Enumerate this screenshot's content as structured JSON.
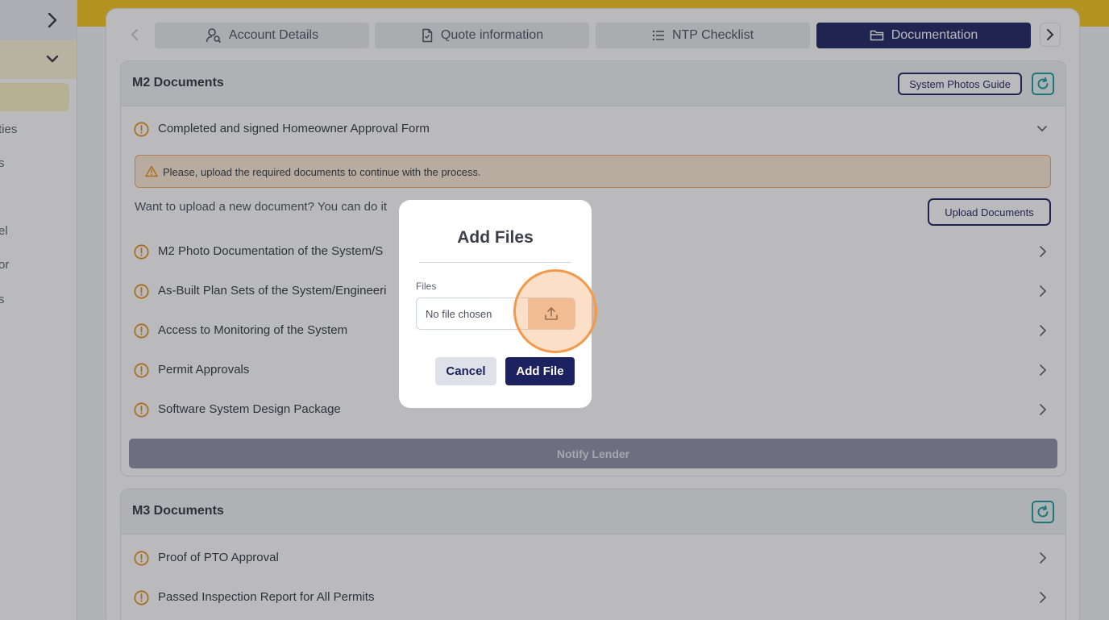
{
  "sidebar": {
    "items": [
      {
        "label": "ties"
      },
      {
        "label": "s"
      },
      {
        "label": "el"
      },
      {
        "label": "or"
      },
      {
        "label": "s"
      }
    ]
  },
  "tabs": [
    {
      "label": "Account Details",
      "icon": "user-search-icon"
    },
    {
      "label": "Quote information",
      "icon": "document-icon"
    },
    {
      "label": "NTP Checklist",
      "icon": "list-icon"
    },
    {
      "label": "Documentation",
      "icon": "folder-icon",
      "active": true
    }
  ],
  "m2": {
    "title": "M2 Documents",
    "guide_label": "System Photos Guide",
    "expanded_item": "Completed and signed Homeowner Approval Form",
    "alert_text": "Please, upload the required documents to continue with the process.",
    "upload_prompt": "Want to upload a new document? You can do it",
    "upload_label": "Upload Documents",
    "items": [
      "M2 Photo Documentation of the System/S",
      "As-Built Plan Sets of the System/Engineeri",
      "Access to Monitoring of the System",
      "Permit Approvals",
      "Software System Design Package"
    ],
    "notify_label": "Notify Lender"
  },
  "m3": {
    "title": "M3 Documents",
    "items": [
      "Proof of PTO Approval",
      "Passed Inspection Report for All Permits"
    ]
  },
  "modal": {
    "title": "Add Files",
    "files_label": "Files",
    "file_placeholder": "No file chosen",
    "cancel_label": "Cancel",
    "add_label": "Add File"
  },
  "colors": {
    "brand_navy": "#1c2260",
    "accent_yellow": "#f5c518",
    "warning_orange": "#e8901a",
    "teal": "#1f9a9a"
  }
}
